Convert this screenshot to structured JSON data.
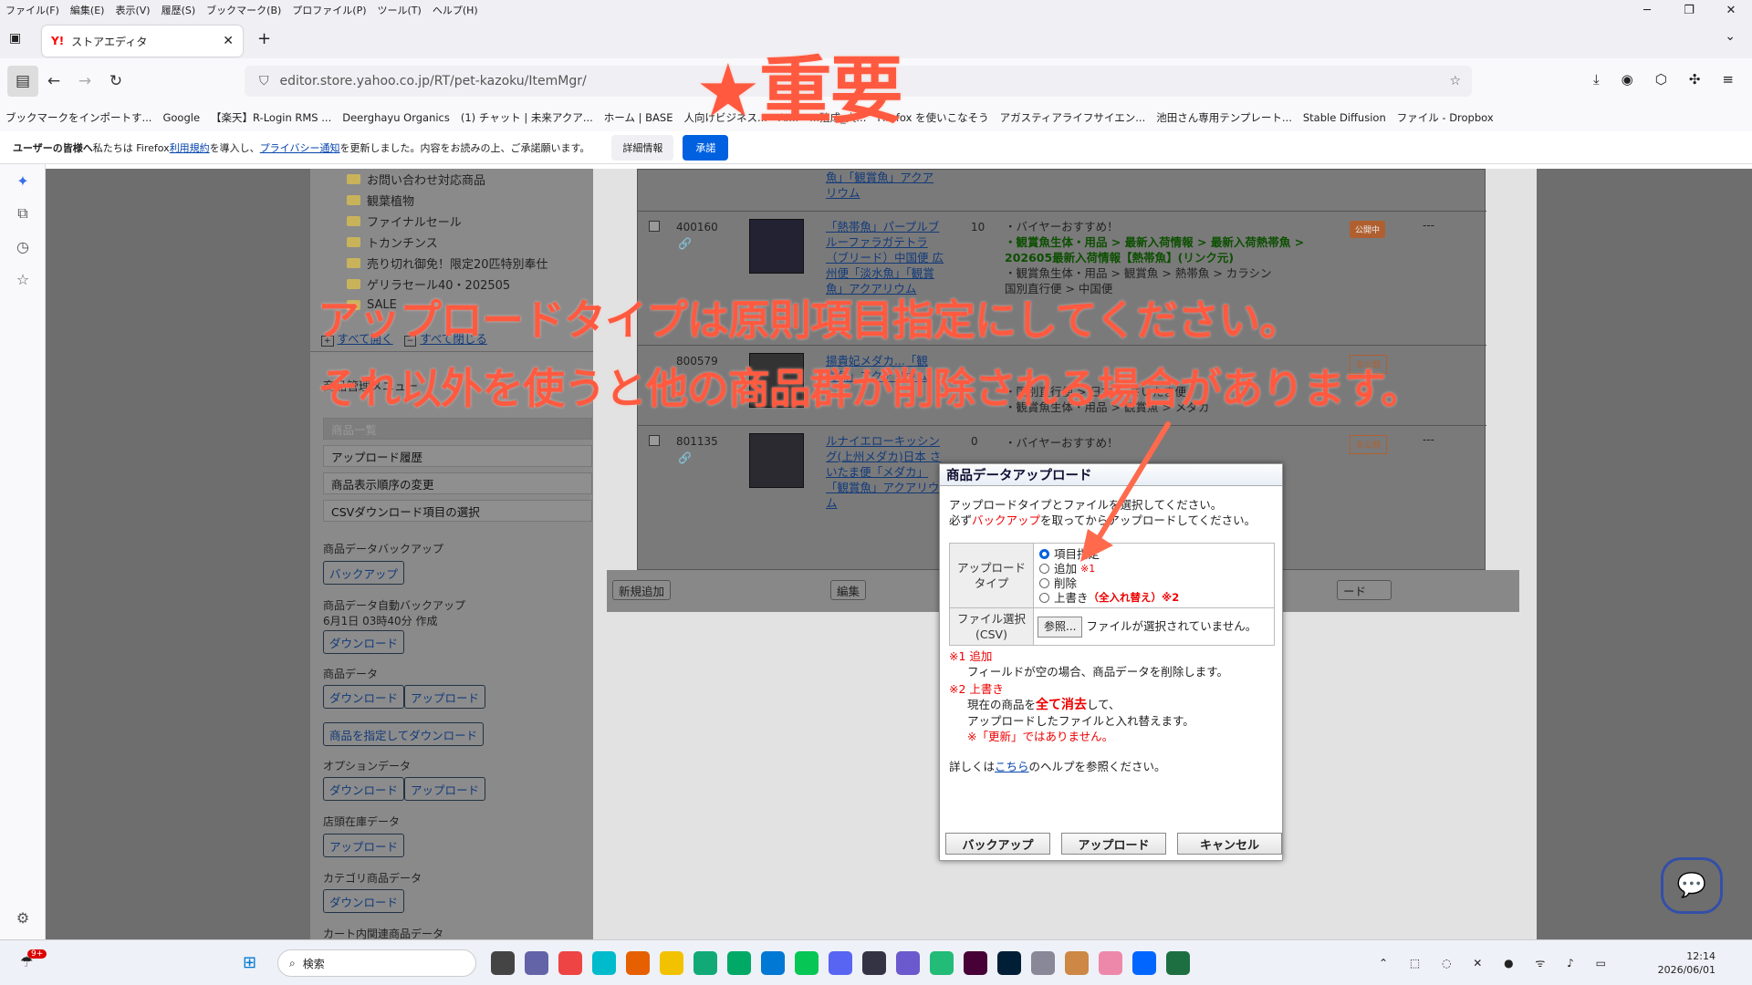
{
  "browser": {
    "menu": [
      "ファイル(F)",
      "編集(E)",
      "表示(V)",
      "履歴(S)",
      "ブックマーク(B)",
      "プロファイル(P)",
      "ツール(T)",
      "ヘルプ(H)"
    ],
    "tab_title": "ストアエディタ",
    "tab_favicon": "Y!",
    "url": "editor.store.yahoo.co.jp/RT/pet-kazoku/ItemMgr/",
    "bookmarks": [
      "ブックマークをインポートす...",
      "Google",
      "【楽天】R-Login RMS ...",
      "Deerghayu Organics",
      "(1) チャット | 未来アクア...",
      "ホーム | BASE",
      "人向けビジネス...",
      "AI...",
      "...殖成_大...",
      "Firefox を使いこなそう",
      "アガスティアライフサイエン...",
      "池田さん専用テンプレート...",
      "Stable Diffusion",
      "ファイル - Dropbox"
    ],
    "notice": {
      "prefix": "ユーザーの皆様へ",
      "text1": " 私たちは Firefox ",
      "link1": "利用規約",
      "text2": " を導入し、",
      "link2": "プライバシー通知",
      "text3": " を更新しました。内容をお読みの上、ご承諾願います。",
      "details_btn": "詳細情報",
      "accept_btn": "承諾"
    }
  },
  "tree": {
    "items": [
      "お問い合わせ対応商品",
      "観葉植物",
      "ファイナルセール",
      "トカンチンス",
      "売り切れ御免！限定20匹特別奉仕",
      "ゲリラセール40・202505",
      "SALE"
    ],
    "expand_all": "すべて開く",
    "collapse_all": "すべて閉じる"
  },
  "left_menu": {
    "title": "商品管理メニュー",
    "items": [
      "商品一覧",
      "アップロード履歴",
      "商品表示順序の変更",
      "CSVダウンロード項目の選択"
    ],
    "backup_label": "商品データバックアップ",
    "backup_btn": "バックアップ",
    "auto_backup_label": "商品データ自動バックアップ",
    "auto_backup_date": "6月1日 03時40分 作成",
    "download_btn": "ダウンロード",
    "product_data_label": "商品データ",
    "upload_btn": "アップロード",
    "specify_download_btn": "商品を指定してダウンロード",
    "option_data_label": "オプションデータ",
    "store_stock_label": "店頭在庫データ",
    "category_data_label": "カテゴリ商品データ",
    "cart_related_label": "カート内関連商品データ"
  },
  "table": {
    "rows": [
      {
        "code": "",
        "name": "魚」「観賞魚」アクアリウム",
        "qty": "",
        "path": "",
        "status": ""
      },
      {
        "code": "400160",
        "name": "「熱帯魚」パープルブルーファラガテトラ（ブリード）中国便 広州便「淡水魚」「観賞魚」アクアリウム",
        "qty": "10",
        "path1": "・バイヤーおすすめ！",
        "path2": "・観賞魚生体・用品 > 最新入荷情報 > 最新入荷熱帯魚 > 202605最新入荷情報【熱帯魚】(リンク元)",
        "path3": "・観賞魚生体・用品 > 観賞魚 > 熱帯魚 > カラシン",
        "path4": "国別直行便 > 中国便",
        "status": "公開中"
      },
      {
        "code": "800579",
        "name": "揚貴妃メダカ...「観賞魚」アクアリウム",
        "qty": "0",
        "path1": "・バイヤーおすすめ！",
        "path3": "・国別直行便 > 日本 > さいたま便",
        "path4": "・観賞魚生体・用品 > 観賞魚 > メダカ",
        "status": "非公開"
      },
      {
        "code": "801135",
        "name": "ルナイエローキッシング(上州メダカ)日本 さいたま便「メダカ」「観賞魚」アクアリウム",
        "qty": "0",
        "path1": "・バイヤーおすすめ！",
        "path2": "カ >",
        "status": "非公開"
      }
    ],
    "new_btn": "新規追加",
    "edit_btn": "編集",
    "upload_tail_btn": "ード",
    "dash": "---"
  },
  "dialog": {
    "title": "商品データアップロード",
    "instr1": "アップロードタイプとファイルを選択してください。",
    "instr2a": "必ず",
    "instr2b": "バックアップ",
    "instr2c": "を取ってからアップロードしてください。",
    "type_label": "アップロードタイプ",
    "options": [
      "項目指定",
      "追加",
      "削除",
      "上書き"
    ],
    "opt_add_note": "※1",
    "opt_overwrite_note": "（全入れ替え）※2",
    "file_label": "ファイル選択(CSV)",
    "browse_btn": "参照...",
    "no_file": "ファイルが選択されていません。",
    "note1_title": "※1 追加",
    "note1_text": "フィールドが空の場合、商品データを削除します。",
    "note2_title": "※2 上書き",
    "note2_a": "現在の商品を",
    "note2_b": "全て消去",
    "note2_c": "して、",
    "note2_d": "アップロードしたファイルと入れ替えます。",
    "note2_e": "※「更新」ではありません。",
    "help_a": "詳しくは",
    "help_link": "こちら",
    "help_b": "のヘルプを参照ください。",
    "backup_btn": "バックアップ",
    "upload_btn": "アップロード",
    "cancel_btn": "キャンセル"
  },
  "overlay": {
    "important": "★重要",
    "line1": "アップロードタイプは原則項目指定にしてください。",
    "line2": "それ以外を使うと他の商品群が削除される場合があります。"
  },
  "taskbar": {
    "search": "検索",
    "time": "12:14",
    "date": "2026/06/01",
    "badge": "9+"
  },
  "colors": {
    "accent": "#0061e0",
    "overlay": "#ff5a40",
    "dialog_red": "#e00"
  }
}
